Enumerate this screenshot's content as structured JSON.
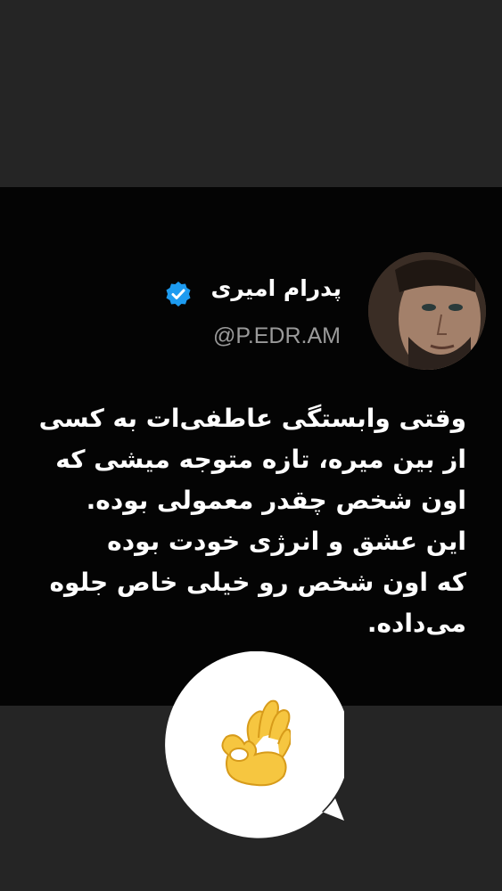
{
  "tweet": {
    "author": {
      "name": "پدرام امیری",
      "handle": "@P.EDR.AM",
      "verified_icon": "verified-badge-icon",
      "avatar_icon": "profile-photo"
    },
    "lines": [
      "وقتی وابستگی عاطفی‌ات به کسی",
      "از بین میره، تازه متوجه میشی که",
      "اون شخص چقدر معمولی بوده.",
      "این عشق و انرژی خودت بوده",
      "که اون شخص رو خیلی خاص جلوه",
      "می‌داده."
    ]
  },
  "reaction": {
    "emoji": "👌",
    "icon": "ok-hand-icon"
  },
  "colors": {
    "background": "#252525",
    "card": "#040404",
    "text": "#ffffff",
    "handle": "#9a9a9a",
    "verified": "#1d9bf0",
    "bubble": "#ffffff",
    "emoji": "#f6c640"
  }
}
